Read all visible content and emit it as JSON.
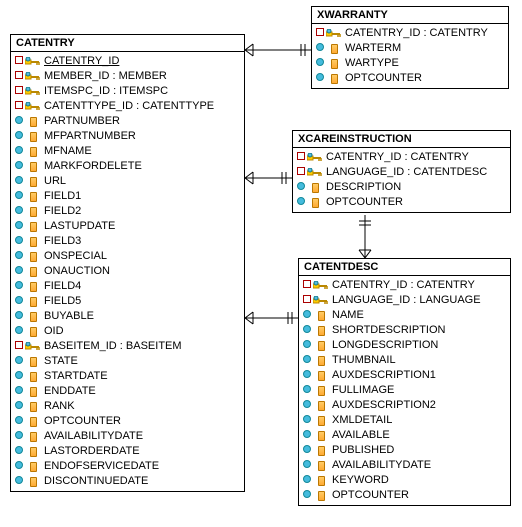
{
  "entities": {
    "catentry": {
      "title": "CATENTRY",
      "fields": [
        {
          "b": "red",
          "i": "key",
          "label": "CATENTRY_ID",
          "u": true
        },
        {
          "b": "red",
          "i": "key",
          "label": "MEMBER_ID : MEMBER"
        },
        {
          "b": "red",
          "i": "key",
          "label": "ITEMSPC_ID : ITEMSPC"
        },
        {
          "b": "red",
          "i": "key",
          "label": "CATENTTYPE_ID : CATENTTYPE"
        },
        {
          "b": "cyan",
          "i": "col",
          "label": "PARTNUMBER"
        },
        {
          "b": "cyan",
          "i": "col",
          "label": "MFPARTNUMBER"
        },
        {
          "b": "cyan",
          "i": "col",
          "label": "MFNAME"
        },
        {
          "b": "cyan",
          "i": "col",
          "label": "MARKFORDELETE"
        },
        {
          "b": "cyan",
          "i": "col",
          "label": "URL"
        },
        {
          "b": "cyan",
          "i": "col",
          "label": "FIELD1"
        },
        {
          "b": "cyan",
          "i": "col",
          "label": "FIELD2"
        },
        {
          "b": "cyan",
          "i": "col",
          "label": "LASTUPDATE"
        },
        {
          "b": "cyan",
          "i": "col",
          "label": "FIELD3"
        },
        {
          "b": "cyan",
          "i": "col",
          "label": "ONSPECIAL"
        },
        {
          "b": "cyan",
          "i": "col",
          "label": "ONAUCTION"
        },
        {
          "b": "cyan",
          "i": "col",
          "label": "FIELD4"
        },
        {
          "b": "cyan",
          "i": "col",
          "label": "FIELD5"
        },
        {
          "b": "cyan",
          "i": "col",
          "label": "BUYABLE"
        },
        {
          "b": "cyan",
          "i": "col",
          "label": "OID"
        },
        {
          "b": "red",
          "i": "key",
          "label": "BASEITEM_ID : BASEITEM"
        },
        {
          "b": "cyan",
          "i": "col",
          "label": "STATE"
        },
        {
          "b": "cyan",
          "i": "col",
          "label": "STARTDATE"
        },
        {
          "b": "cyan",
          "i": "col",
          "label": "ENDDATE"
        },
        {
          "b": "cyan",
          "i": "col",
          "label": "RANK"
        },
        {
          "b": "cyan",
          "i": "col",
          "label": "OPTCOUNTER"
        },
        {
          "b": "cyan",
          "i": "col",
          "label": "AVAILABILITYDATE"
        },
        {
          "b": "cyan",
          "i": "col",
          "label": "LASTORDERDATE"
        },
        {
          "b": "cyan",
          "i": "col",
          "label": "ENDOFSERVICEDATE"
        },
        {
          "b": "cyan",
          "i": "col",
          "label": "DISCONTINUEDATE"
        }
      ]
    },
    "xwarranty": {
      "title": "XWARRANTY",
      "fields": [
        {
          "b": "red",
          "i": "key",
          "label": "CATENTRY_ID : CATENTRY"
        },
        {
          "b": "cyan",
          "i": "col",
          "label": "WARTERM"
        },
        {
          "b": "cyan",
          "i": "col",
          "label": "WARTYPE"
        },
        {
          "b": "cyan",
          "i": "col",
          "label": "OPTCOUNTER"
        }
      ]
    },
    "xcare": {
      "title": "XCAREINSTRUCTION",
      "fields": [
        {
          "b": "red",
          "i": "key",
          "label": "CATENTRY_ID : CATENTRY"
        },
        {
          "b": "red",
          "i": "key",
          "label": "LANGUAGE_ID : CATENTDESC"
        },
        {
          "b": "cyan",
          "i": "col",
          "label": "DESCRIPTION"
        },
        {
          "b": "cyan",
          "i": "col",
          "label": "OPTCOUNTER"
        }
      ]
    },
    "catentdesc": {
      "title": "CATENTDESC",
      "fields": [
        {
          "b": "red",
          "i": "key",
          "label": "CATENTRY_ID : CATENTRY"
        },
        {
          "b": "red",
          "i": "key",
          "label": "LANGUAGE_ID : LANGUAGE"
        },
        {
          "b": "cyan",
          "i": "col",
          "label": "NAME"
        },
        {
          "b": "cyan",
          "i": "col",
          "label": "SHORTDESCRIPTION"
        },
        {
          "b": "cyan",
          "i": "col",
          "label": "LONGDESCRIPTION"
        },
        {
          "b": "cyan",
          "i": "col",
          "label": "THUMBNAIL"
        },
        {
          "b": "cyan",
          "i": "col",
          "label": "AUXDESCRIPTION1"
        },
        {
          "b": "cyan",
          "i": "col",
          "label": "FULLIMAGE"
        },
        {
          "b": "cyan",
          "i": "col",
          "label": "AUXDESCRIPTION2"
        },
        {
          "b": "cyan",
          "i": "col",
          "label": "XMLDETAIL"
        },
        {
          "b": "cyan",
          "i": "col",
          "label": "AVAILABLE"
        },
        {
          "b": "cyan",
          "i": "col",
          "label": "PUBLISHED"
        },
        {
          "b": "cyan",
          "i": "col",
          "label": "AVAILABILITYDATE"
        },
        {
          "b": "cyan",
          "i": "col",
          "label": "KEYWORD"
        },
        {
          "b": "cyan",
          "i": "col",
          "label": "OPTCOUNTER"
        }
      ]
    }
  }
}
